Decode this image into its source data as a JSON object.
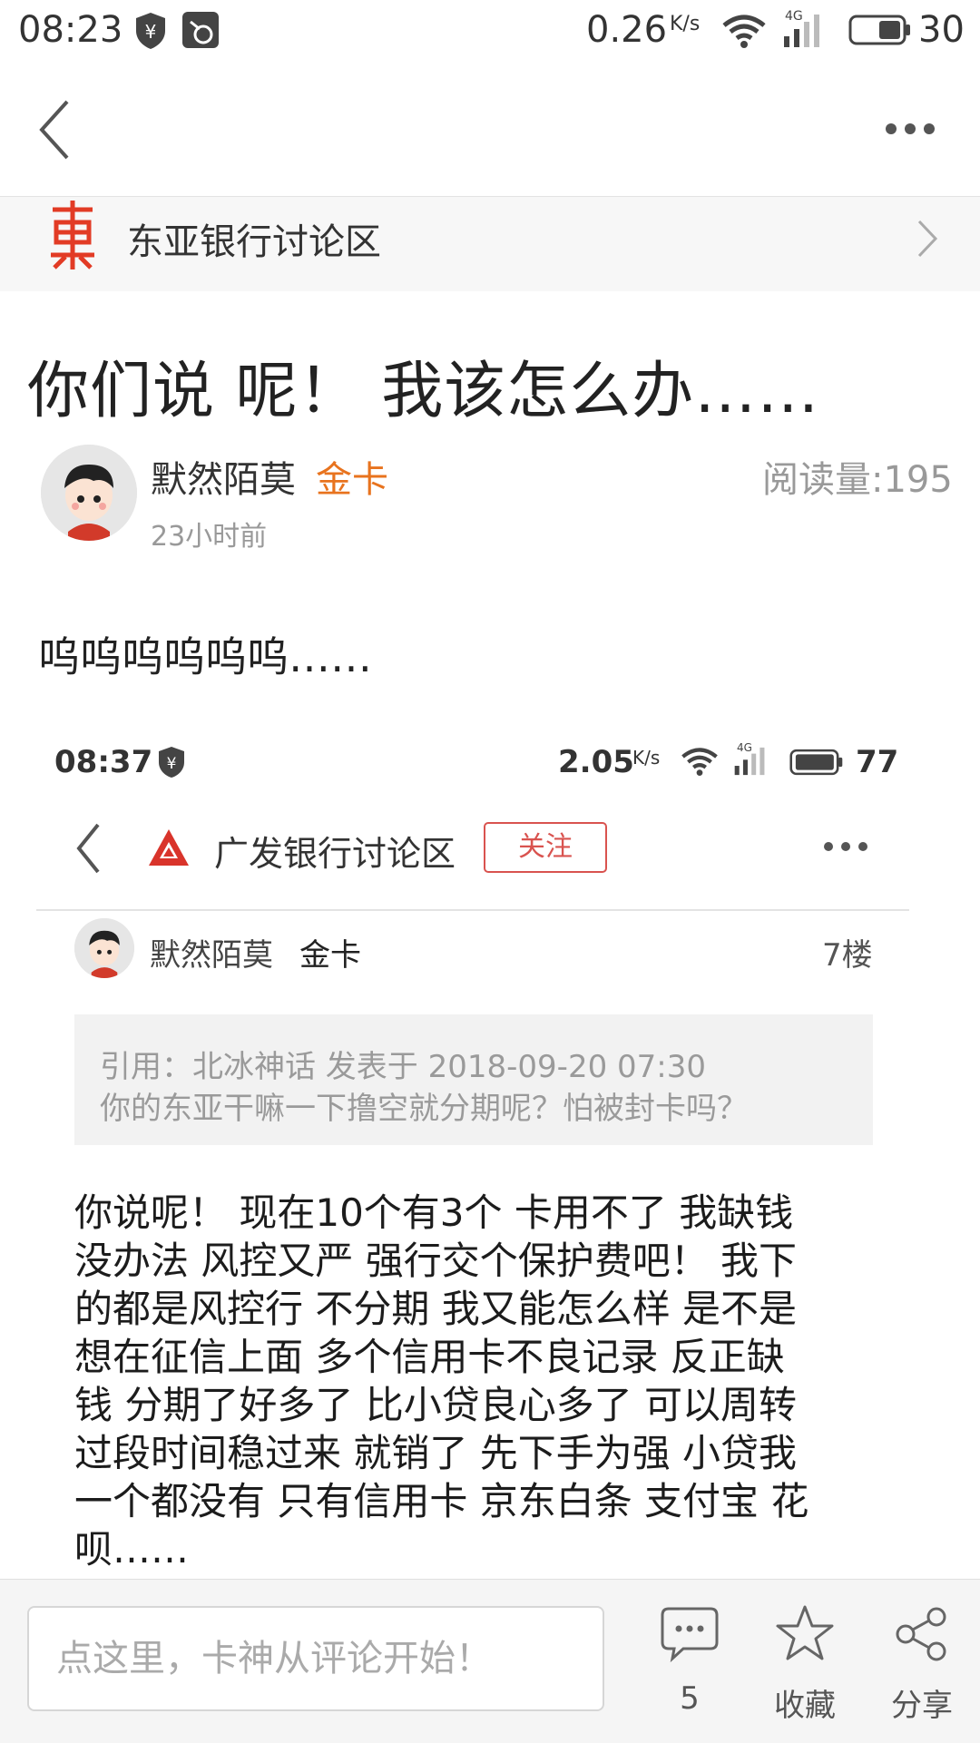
{
  "status_bar": {
    "time": "08:23",
    "speed": "0.26",
    "speed_unit": "K/s",
    "network": "4G",
    "battery": "30"
  },
  "nav": {
    "back_icon": "chevron-left-icon",
    "more_icon": "more-horizontal-icon"
  },
  "forum": {
    "name": "东亚银行讨论区",
    "logo_icon": "bank-of-east-asia-logo",
    "brand_color": "#e23b25"
  },
  "post": {
    "title": "你们说 呢！  我该怎么办……",
    "author": "默然陌莫",
    "author_badge": "金卡",
    "time": "23小时前",
    "read_count": "阅读量:195",
    "body": "呜呜呜呜呜呜……"
  },
  "embedded_screenshot": {
    "status_time": "08:37",
    "status_speed": "2.05",
    "status_speed_unit": "K/s",
    "status_network": "4G",
    "status_battery": "77",
    "forum_name": "广发银行讨论区",
    "forum_logo_icon": "guangfa-bank-logo",
    "follow_label": "关注",
    "author": "默然陌莫",
    "author_badge": "金卡",
    "floor": "7楼",
    "quote_line1": "引用：北冰神话 发表于 2018-09-20 07:30",
    "quote_line2": "你的东亚干嘛一下撸空就分期呢？怕被封卡吗？",
    "reply_lines": [
      "你说呢！ 现在10个有3个 卡用不了 我缺钱",
      "没办法 风控又严 强行交个保护费吧！ 我下",
      "的都是风控行 不分期 我又能怎么样 是不是",
      "想在征信上面 多个信用卡不良记录 反正缺",
      "钱 分期了好多了 比小贷良心多了 可以周转",
      "过段时间稳过来 就销了 先下手为强 小贷我",
      "一个都没有 只有信用卡 京东白条 支付宝 花",
      "呗……"
    ]
  },
  "bottom_bar": {
    "comment_placeholder": "点这里，卡神从评论开始！",
    "comment_count": "5",
    "favorite_label": "收藏",
    "share_label": "分享"
  }
}
